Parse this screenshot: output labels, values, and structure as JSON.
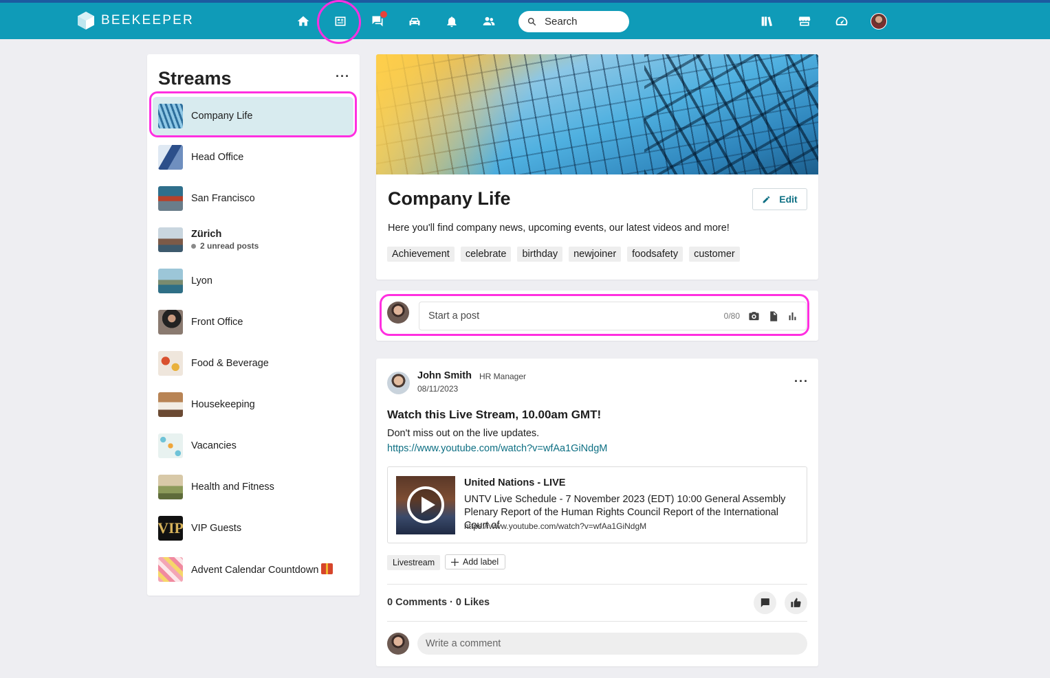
{
  "app": {
    "name": "BEEKEEPER"
  },
  "topbar": {
    "nav": [
      {
        "name": "home-icon"
      },
      {
        "name": "streams-icon"
      },
      {
        "name": "chat-icon",
        "badge": true
      },
      {
        "name": "shifts-icon"
      },
      {
        "name": "notifications-icon"
      },
      {
        "name": "people-icon"
      }
    ],
    "search_placeholder": "Search",
    "right_icons": [
      "library-icon",
      "store-icon",
      "dashboard-icon"
    ]
  },
  "sidebar": {
    "title": "Streams",
    "items": [
      {
        "label": "Company Life",
        "active": true
      },
      {
        "label": "Head Office"
      },
      {
        "label": "San Francisco"
      },
      {
        "label": "Zürich",
        "unread": "2 unread posts"
      },
      {
        "label": "Lyon"
      },
      {
        "label": "Front Office"
      },
      {
        "label": "Food & Beverage"
      },
      {
        "label": "Housekeeping"
      },
      {
        "label": "Vacancies"
      },
      {
        "label": "Health and Fitness"
      },
      {
        "label": "VIP Guests"
      },
      {
        "label": "Advent Calendar Countdown"
      }
    ]
  },
  "stream": {
    "title": "Company Life",
    "edit_label": "Edit",
    "description": "Here you'll find company news, upcoming events, our latest videos and more!",
    "tags": [
      "Achievement",
      "celebrate",
      "birthday",
      "newjoiner",
      "foodsafety",
      "customer"
    ]
  },
  "composer": {
    "placeholder": "Start a post",
    "counter": "0/80"
  },
  "post": {
    "author": "John Smith",
    "role": "HR Manager",
    "date": "08/11/2023",
    "title": "Watch this Live Stream, 10.00am GMT!",
    "body": "Don't miss out on the live updates.",
    "link": "https://www.youtube.com/watch?v=wfAa1GiNdgM",
    "preview": {
      "title": "United Nations - LIVE",
      "description": "UNTV Live Schedule - 7 November 2023 (EDT) 10:00 General Assembly Plenary Report of the Human Rights Council Report of the International Court of",
      "url": "https://www.youtube.com/watch?v=wfAa1GiNdgM"
    },
    "label": "Livestream",
    "add_label": "Add label",
    "stats": "0 Comments · 0 Likes",
    "comment_placeholder": "Write a comment"
  },
  "colors": {
    "topbar": "#0f9bb8",
    "accent": "#0d6f83",
    "annotation": "#ff2fe0"
  }
}
